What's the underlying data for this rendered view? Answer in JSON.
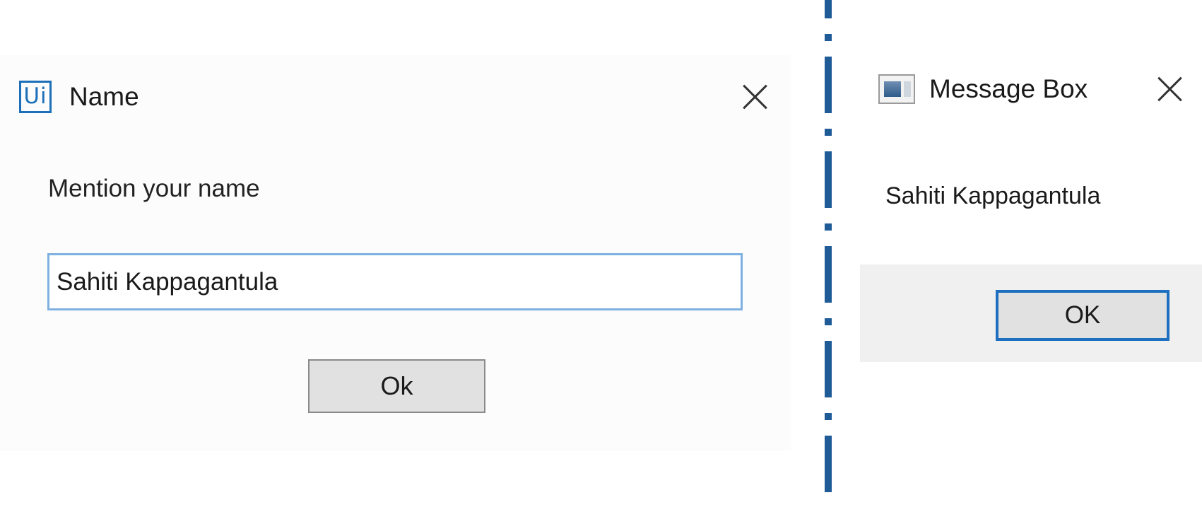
{
  "name_dialog": {
    "logo_text": "Ui",
    "title": "Name",
    "prompt": "Mention your name",
    "input_value": "Sahiti Kappagantula",
    "ok_label": "Ok"
  },
  "message_box": {
    "title": "Message Box",
    "message": "Sahiti Kappagantula",
    "ok_label": "OK"
  },
  "colors": {
    "accent": "#1e6fc0",
    "divider": "#1e5b97",
    "logo": "#1c6fb8"
  },
  "icons": {
    "name_dialog_logo": "uipath-logo-icon",
    "message_box_window": "window-icon",
    "close": "close-icon"
  }
}
